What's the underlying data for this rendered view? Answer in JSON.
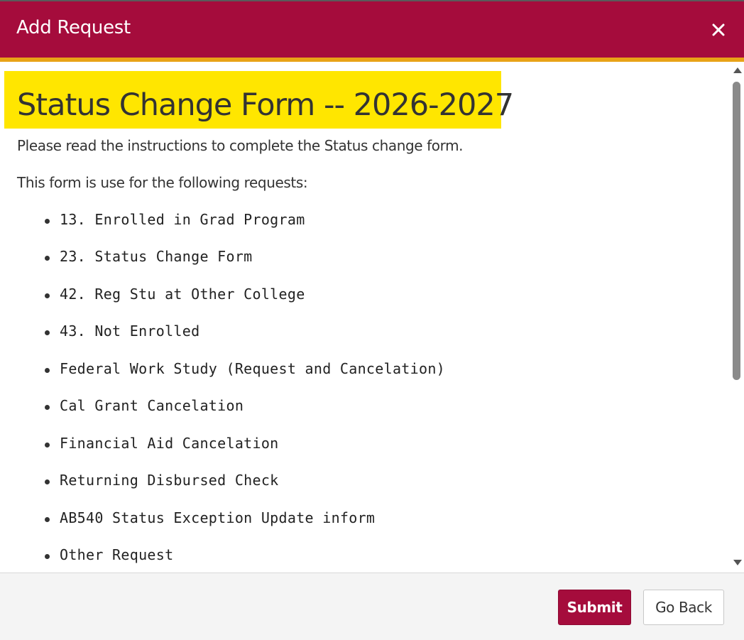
{
  "dialog": {
    "title": "Add Request",
    "close_icon": "close-icon",
    "close_symbol": "✕"
  },
  "content": {
    "form_title": "Status Change Form -- 2026-2027",
    "instructions": "Please read the instructions to complete the Status change form.",
    "list_intro": "This form is use for the following requests:",
    "requests": [
      "13. Enrolled in Grad Program",
      "23. Status Change Form",
      "42. Reg Stu at Other College",
      "43. Not Enrolled",
      "Federal Work Study (Request and Cancelation)",
      "Cal Grant Cancelation",
      "Financial Aid Cancelation",
      "Returning Disbursed Check",
      "AB540 Status Exception Update inform",
      "Other Request"
    ]
  },
  "footer": {
    "submit_label": "Submit",
    "back_label": "Go Back"
  },
  "colors": {
    "header_bg": "#a50c3c",
    "accent_bar": "#e8a317",
    "title_highlight": "#ffe600",
    "submit_bg": "#a50c3c"
  }
}
